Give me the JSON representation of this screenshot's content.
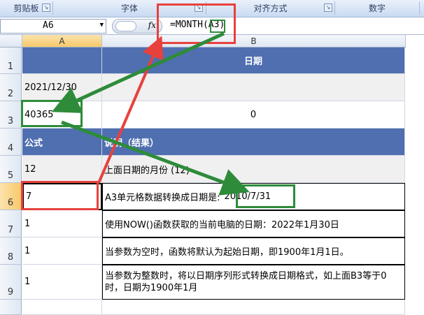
{
  "ribbon": {
    "groups": [
      "剪贴板",
      "字体",
      "对齐方式",
      "数字"
    ]
  },
  "formula_bar": {
    "name_box": "A6",
    "fx_label": "fx",
    "formula": "=MONTH(A3)"
  },
  "columns": [
    "A",
    "B"
  ],
  "rows": [
    "1",
    "2",
    "3",
    "4",
    "5",
    "6",
    "7",
    "8",
    "9"
  ],
  "cells": {
    "b1": "日期",
    "a2": "2021/12/30",
    "a3": "40365",
    "b3": "0",
    "a4": "公式",
    "b4": "说明（结果）",
    "a5": "12",
    "b5": "上面日期的月份 (12)",
    "a6": "7",
    "b6_text": "A3单元格数据转换成日期是:",
    "b6_date": "2010/7/31",
    "a7": "1",
    "b7": "使用NOW()函数获取的当前电脑的日期：2022年1月30日",
    "a8": "1",
    "b8": "当参数为空时，函数将默认为起始日期，即1900年1月1日。",
    "a9": "1",
    "b9": "当参数为整数时，将以日期序列形式转换成日期格式，如上面B3等于0时，日期为1900年1月"
  },
  "colors": {
    "header_band": "#4f6fb0",
    "red_highlight": "#e8413c",
    "green_highlight": "#2e8b3a"
  }
}
